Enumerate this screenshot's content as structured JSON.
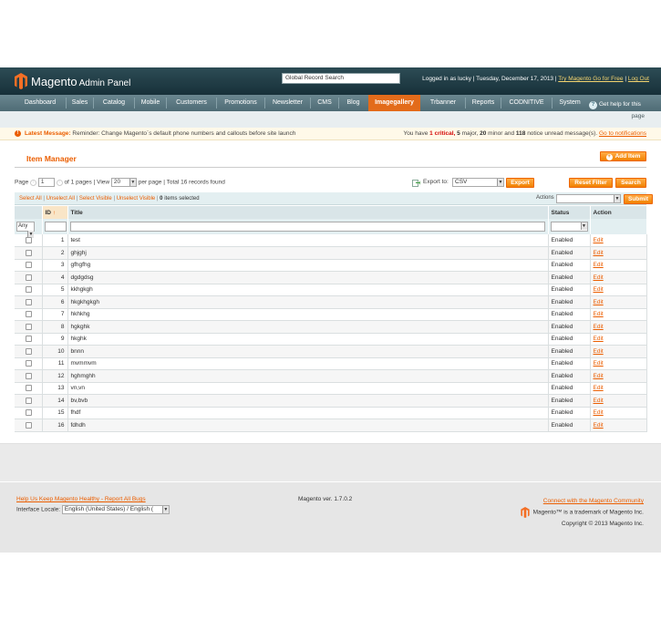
{
  "header": {
    "logo_text": "Magento",
    "logo_sub": "Admin Panel",
    "search_placeholder": "Global Record Search",
    "logged_in": "Logged in as lucky",
    "date": "Tuesday, December 17, 2013",
    "try_link": "Try Magento Go for Free",
    "logout": "Log Out"
  },
  "nav": {
    "items": [
      "Dashboard",
      "Sales",
      "Catalog",
      "Mobile",
      "Customers",
      "Promotions",
      "Newsletter",
      "CMS",
      "Blog",
      "Imagegallery",
      "Trbanner",
      "Reports",
      "CODNITIVE",
      "System"
    ],
    "active": "Imagegallery",
    "help": "Get help for this",
    "help_page": "page"
  },
  "message": {
    "label": "Latest Message:",
    "text": "Reminder: Change Magento`s default phone numbers and callouts before site launch",
    "prefix": "You have",
    "critical_count": "1",
    "critical_word": "critical,",
    "major_count": "5",
    "major_word": "major,",
    "minor_count": "20",
    "minor_word": "minor and",
    "notice_count": "118",
    "notice_word": "notice unread message(s).",
    "link": "Go to notifications"
  },
  "page": {
    "title": "Item Manager",
    "add_button": "Add Item"
  },
  "pager": {
    "page_label": "Page",
    "page_value": "1",
    "of_pages": "of 1 pages",
    "view_label": "View",
    "per_page_value": "20",
    "per_page_label": "per page",
    "total": "Total 16 records found",
    "export_label": "Export to:",
    "export_value": "CSV",
    "export_button": "Export",
    "reset_button": "Reset Filter",
    "search_button": "Search"
  },
  "mass": {
    "select_all": "Select All",
    "unselect_all": "Unselect All",
    "select_visible": "Select Visible",
    "unselect_visible": "Unselect Visible",
    "selected_count": "0",
    "selected_text": "items selected",
    "actions_label": "Actions",
    "submit": "Submit"
  },
  "grid": {
    "columns": {
      "id": "ID",
      "title": "Title",
      "status": "Status",
      "action": "Action"
    },
    "filter_any": "Any",
    "rows": [
      {
        "id": "1",
        "title": "test",
        "status": "Enabled",
        "action": "Edit"
      },
      {
        "id": "2",
        "title": "ghjghj",
        "status": "Enabled",
        "action": "Edit"
      },
      {
        "id": "3",
        "title": "gfhgfhg",
        "status": "Enabled",
        "action": "Edit"
      },
      {
        "id": "4",
        "title": "dgdgdsg",
        "status": "Enabled",
        "action": "Edit"
      },
      {
        "id": "5",
        "title": "kkhgkgh",
        "status": "Enabled",
        "action": "Edit"
      },
      {
        "id": "6",
        "title": "hkgkhgkgh",
        "status": "Enabled",
        "action": "Edit"
      },
      {
        "id": "7",
        "title": "hkhkhg",
        "status": "Enabled",
        "action": "Edit"
      },
      {
        "id": "8",
        "title": "hgkghk",
        "status": "Enabled",
        "action": "Edit"
      },
      {
        "id": "9",
        "title": "hkghk",
        "status": "Enabled",
        "action": "Edit"
      },
      {
        "id": "10",
        "title": "bnnn",
        "status": "Enabled",
        "action": "Edit"
      },
      {
        "id": "11",
        "title": "mvmmvm",
        "status": "Enabled",
        "action": "Edit"
      },
      {
        "id": "12",
        "title": "hghmghh",
        "status": "Enabled",
        "action": "Edit"
      },
      {
        "id": "13",
        "title": "vn,vn",
        "status": "Enabled",
        "action": "Edit"
      },
      {
        "id": "14",
        "title": "bv,bvb",
        "status": "Enabled",
        "action": "Edit"
      },
      {
        "id": "15",
        "title": "fhdf",
        "status": "Enabled",
        "action": "Edit"
      },
      {
        "id": "16",
        "title": "fdhdh",
        "status": "Enabled",
        "action": "Edit"
      }
    ]
  },
  "footer": {
    "help_link": "Help Us Keep Magento Healthy - Report All Bugs",
    "locale_label": "Interface Locale:",
    "locale_value": "English (United States) / English (",
    "version": "Magento ver. 1.7.0.2",
    "community_link": "Connect with the Magento Community",
    "trademark": "Magento™ is a trademark of Magento Inc.",
    "copyright": "Copyright © 2013 Magento Inc."
  },
  "colors": {
    "accent": "#eb5e00",
    "header": "#1c3d46",
    "nav_active": "#e36b1a"
  }
}
